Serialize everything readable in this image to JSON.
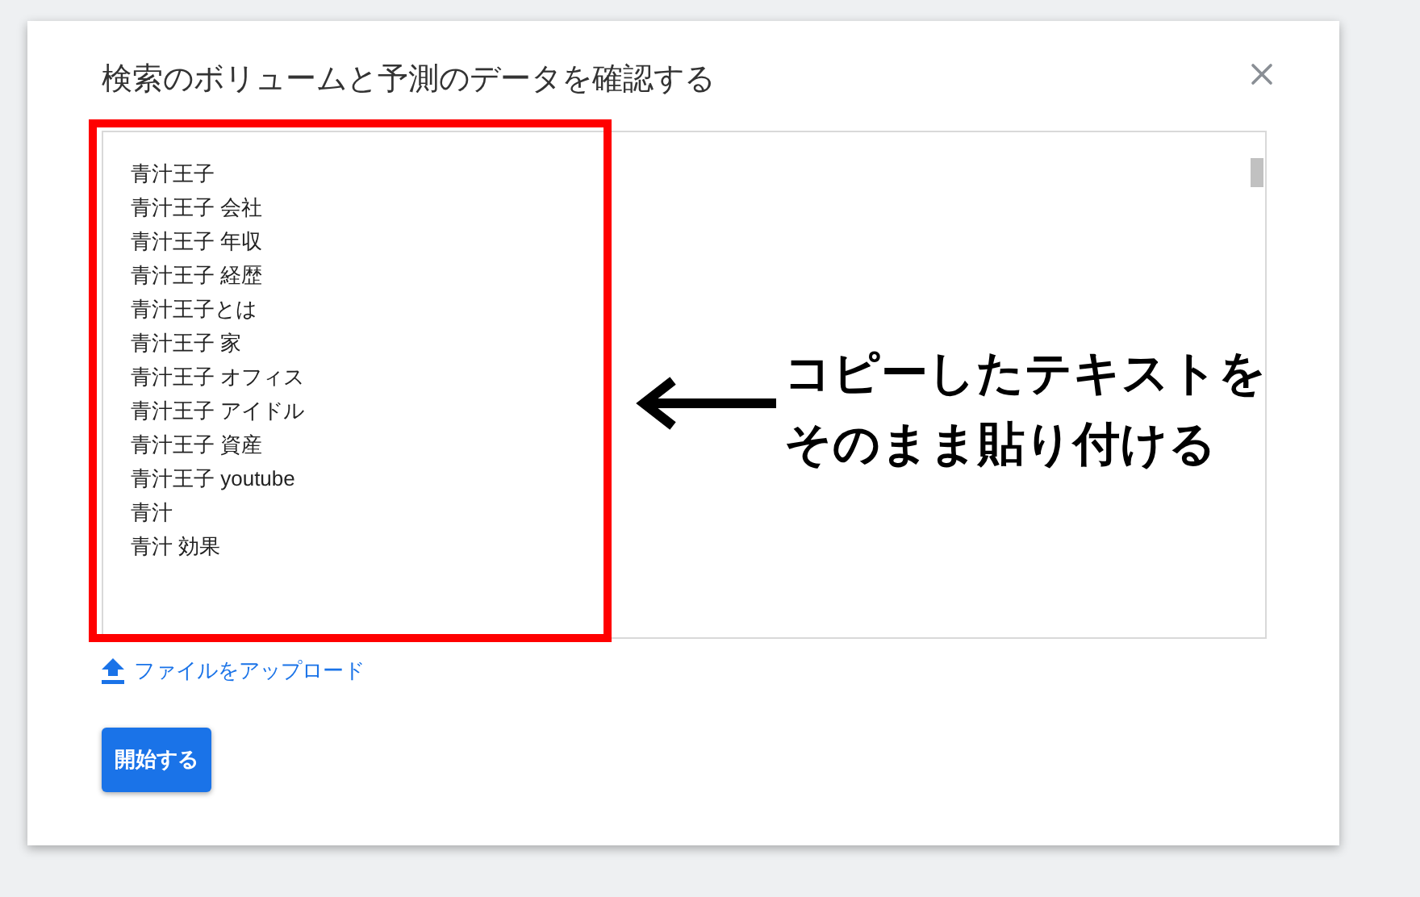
{
  "dialog": {
    "title": "検索のボリュームと予測のデータを確認する",
    "keywords": [
      "青汁王子",
      "青汁王子 会社",
      "青汁王子 年収",
      "青汁王子 経歴",
      "青汁王子とは",
      "青汁王子 家",
      "青汁王子 オフィス",
      "青汁王子 アイドル",
      "青汁王子 資産",
      "青汁王子 youtube",
      "青汁",
      "青汁 効果"
    ],
    "upload_link": "ファイルをアップロード",
    "start_button": "開始する"
  },
  "annotation": {
    "lines": [
      "コピーしたテキストを",
      "そのまま貼り付ける"
    ]
  }
}
